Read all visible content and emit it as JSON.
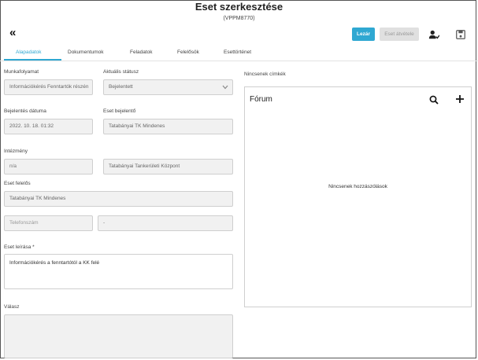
{
  "header": {
    "title": "Eset szerkesztése",
    "subtitle": "(VPPM8770)",
    "back_glyph": "«",
    "close_button": "Lezár",
    "take_button": "Eset átvétele",
    "assign_icon": "assign-user-icon",
    "save_icon": "save-icon"
  },
  "tabs": [
    {
      "label": "Alapadatok"
    },
    {
      "label": "Dokumentumok"
    },
    {
      "label": "Feladatok"
    },
    {
      "label": "Felelősök"
    },
    {
      "label": "Esettörténet"
    }
  ],
  "form": {
    "workflow_label": "Munkafolyamat",
    "workflow_value": "Információkérés Fenntartók részén",
    "status_label": "Aktuális státusz",
    "status_value": "Bejelentett",
    "report_date_label": "Bejelentés dátuma",
    "report_date_value": "2022. 10. 18. 01:32",
    "reporter_label": "Eset bejelentő",
    "reporter_value": "Tatabányai TK Mindenes",
    "institution_label": "Intézmény",
    "institution_value": "n/a",
    "institution2_value": "Tatabányai Tankerületi Központ",
    "responsible_label": "Eset felelős",
    "responsible_value": "Tatabányai TK Mindenes",
    "phone_placeholder": "Telefonszám",
    "phone2_value": "-",
    "description_label": "Eset leírása *",
    "description_value": "Információkérés a fenntartótól a KK felé",
    "answer_label": "Válasz"
  },
  "side": {
    "no_tags": "Nincsenek címkék",
    "forum_title": "Fórum",
    "no_comments": "Nincsenek hozzászólások"
  },
  "colors": {
    "accent": "#2fa8d2"
  }
}
